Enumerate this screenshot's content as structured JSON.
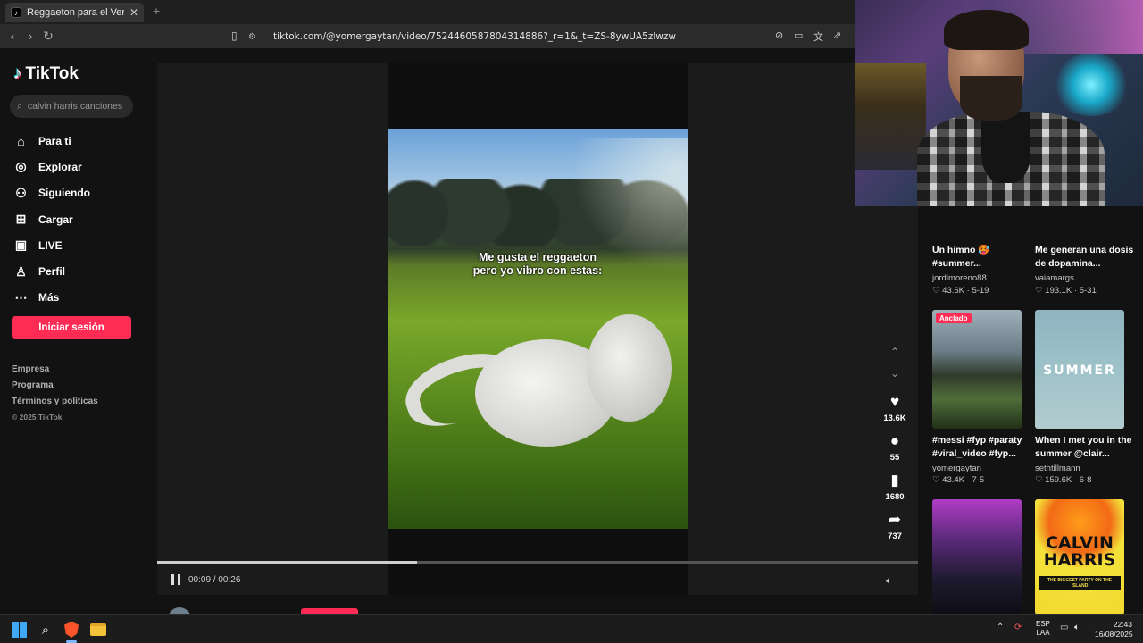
{
  "browser": {
    "tab_title": "Reggaeton para el Verano: Vi",
    "tab_close": "✕",
    "new_tab": "+",
    "url": "tiktok.com/@yomergaytan/video/7524460587804314886?_r=1&_t=ZS-8ywUA5zlwzw"
  },
  "tiktok": {
    "logo_text": "TikTok",
    "search_placeholder": "calvin harris canciones",
    "nav": [
      {
        "label": "Para ti",
        "icon": "home-icon"
      },
      {
        "label": "Explorar",
        "icon": "compass-icon"
      },
      {
        "label": "Siguiendo",
        "icon": "following-icon"
      },
      {
        "label": "Cargar",
        "icon": "upload-icon"
      },
      {
        "label": "LIVE",
        "icon": "live-tv-icon"
      },
      {
        "label": "Perfil",
        "icon": "profile-icon"
      },
      {
        "label": "Más",
        "icon": "more-icon"
      }
    ],
    "login_button": "Iniciar sesión",
    "footer": {
      "links": [
        "Empresa",
        "Programa",
        "Términos y políticas"
      ],
      "copyright": "© 2025 TikTok"
    }
  },
  "video": {
    "caption_line1": "Me gusta el reggaeton",
    "caption_line2": "pero yo vibro con estas:",
    "time": "00:09 / 00:26",
    "progress": 0.342,
    "author": "yomergaytan"
  },
  "actions": {
    "likes": "13.6K",
    "comments": "55",
    "saves": "1680",
    "shares": "737"
  },
  "related": [
    {
      "title": "Un himno 🥵 #summer...",
      "user": "jordimoreno88",
      "likes": "43.6K",
      "date": "5-19"
    },
    {
      "title": "Me generan una dosis de dopamina...",
      "user": "vaiamargs",
      "likes": "193.1K",
      "date": "5-31"
    },
    {
      "title": "#messi #fyp #paraty #viral_video #fyp...",
      "user": "yomergaytan",
      "likes": "43.4K",
      "date": "7-5",
      "badge": "Anclado"
    },
    {
      "title": "When I met you in the summer @clair...",
      "user": "sethtillmann",
      "likes": "159.6K",
      "date": "6-8",
      "overlay": "SUMMER"
    },
    {
      "overlay_line1": "CALVIN",
      "overlay_line2": "HARRIS",
      "overlay_sub": "THE BIGGEST PARTY ON THE ISLAND"
    }
  ],
  "taskbar": {
    "lang_line1": "ESP",
    "lang_line2": "LAA",
    "time": "22:43",
    "date": "16/08/2025"
  }
}
